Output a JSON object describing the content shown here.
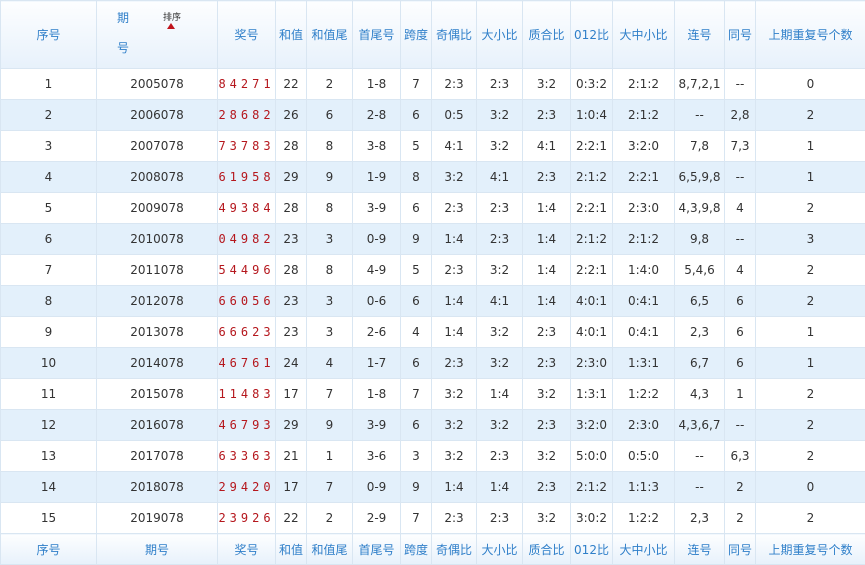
{
  "header": {
    "xuhao": "序号",
    "qihao_1": "期",
    "qihao_2": "号",
    "sort_label": "排序",
    "jianghao": "奖号",
    "hezhi": "和值",
    "hezhiwei": "和值尾",
    "shouweihao": "首尾号",
    "kuadu": "跨度",
    "jiou": "奇偶比",
    "daxiao": "大小比",
    "zhihe": "质合比",
    "b012": "012比",
    "dazhongxiao": "大中小比",
    "lianhao": "连号",
    "tonghao": "同号",
    "chongfu": "上期重复号个数"
  },
  "footer": {
    "xuhao": "序号",
    "qihao": "期号",
    "jianghao": "奖号",
    "hezhi": "和值",
    "hezhiwei": "和值尾",
    "shouweihao": "首尾号",
    "kuadu": "跨度",
    "jiou": "奇偶比",
    "daxiao": "大小比",
    "zhihe": "质合比",
    "b012": "012比",
    "dazhongxiao": "大中小比",
    "lianhao": "连号",
    "tonghao": "同号",
    "chongfu": "上期重复号个数"
  },
  "rows": [
    {
      "xuhao": "1",
      "qihao": "2005078",
      "jianghao": "84271",
      "hezhi": "22",
      "hezhiwei": "2",
      "shouweihao": "1-8",
      "kuadu": "7",
      "jiou": "2:3",
      "daxiao": "2:3",
      "zhihe": "3:2",
      "b012": "0:3:2",
      "dazhongxiao": "2:1:2",
      "lianhao": "8,7,2,1",
      "tonghao": "--",
      "chongfu": "0"
    },
    {
      "xuhao": "2",
      "qihao": "2006078",
      "jianghao": "28682",
      "hezhi": "26",
      "hezhiwei": "6",
      "shouweihao": "2-8",
      "kuadu": "6",
      "jiou": "0:5",
      "daxiao": "3:2",
      "zhihe": "2:3",
      "b012": "1:0:4",
      "dazhongxiao": "2:1:2",
      "lianhao": "--",
      "tonghao": "2,8",
      "chongfu": "2"
    },
    {
      "xuhao": "3",
      "qihao": "2007078",
      "jianghao": "73783",
      "hezhi": "28",
      "hezhiwei": "8",
      "shouweihao": "3-8",
      "kuadu": "5",
      "jiou": "4:1",
      "daxiao": "3:2",
      "zhihe": "4:1",
      "b012": "2:2:1",
      "dazhongxiao": "3:2:0",
      "lianhao": "7,8",
      "tonghao": "7,3",
      "chongfu": "1"
    },
    {
      "xuhao": "4",
      "qihao": "2008078",
      "jianghao": "61958",
      "hezhi": "29",
      "hezhiwei": "9",
      "shouweihao": "1-9",
      "kuadu": "8",
      "jiou": "3:2",
      "daxiao": "4:1",
      "zhihe": "2:3",
      "b012": "2:1:2",
      "dazhongxiao": "2:2:1",
      "lianhao": "6,5,9,8",
      "tonghao": "--",
      "chongfu": "1"
    },
    {
      "xuhao": "5",
      "qihao": "2009078",
      "jianghao": "49384",
      "hezhi": "28",
      "hezhiwei": "8",
      "shouweihao": "3-9",
      "kuadu": "6",
      "jiou": "2:3",
      "daxiao": "2:3",
      "zhihe": "1:4",
      "b012": "2:2:1",
      "dazhongxiao": "2:3:0",
      "lianhao": "4,3,9,8",
      "tonghao": "4",
      "chongfu": "2"
    },
    {
      "xuhao": "6",
      "qihao": "2010078",
      "jianghao": "04982",
      "hezhi": "23",
      "hezhiwei": "3",
      "shouweihao": "0-9",
      "kuadu": "9",
      "jiou": "1:4",
      "daxiao": "2:3",
      "zhihe": "1:4",
      "b012": "2:1:2",
      "dazhongxiao": "2:1:2",
      "lianhao": "9,8",
      "tonghao": "--",
      "chongfu": "3"
    },
    {
      "xuhao": "7",
      "qihao": "2011078",
      "jianghao": "54496",
      "hezhi": "28",
      "hezhiwei": "8",
      "shouweihao": "4-9",
      "kuadu": "5",
      "jiou": "2:3",
      "daxiao": "3:2",
      "zhihe": "1:4",
      "b012": "2:2:1",
      "dazhongxiao": "1:4:0",
      "lianhao": "5,4,6",
      "tonghao": "4",
      "chongfu": "2"
    },
    {
      "xuhao": "8",
      "qihao": "2012078",
      "jianghao": "66056",
      "hezhi": "23",
      "hezhiwei": "3",
      "shouweihao": "0-6",
      "kuadu": "6",
      "jiou": "1:4",
      "daxiao": "4:1",
      "zhihe": "1:4",
      "b012": "4:0:1",
      "dazhongxiao": "0:4:1",
      "lianhao": "6,5",
      "tonghao": "6",
      "chongfu": "2"
    },
    {
      "xuhao": "9",
      "qihao": "2013078",
      "jianghao": "66623",
      "hezhi": "23",
      "hezhiwei": "3",
      "shouweihao": "2-6",
      "kuadu": "4",
      "jiou": "1:4",
      "daxiao": "3:2",
      "zhihe": "2:3",
      "b012": "4:0:1",
      "dazhongxiao": "0:4:1",
      "lianhao": "2,3",
      "tonghao": "6",
      "chongfu": "1"
    },
    {
      "xuhao": "10",
      "qihao": "2014078",
      "jianghao": "46761",
      "hezhi": "24",
      "hezhiwei": "4",
      "shouweihao": "1-7",
      "kuadu": "6",
      "jiou": "2:3",
      "daxiao": "3:2",
      "zhihe": "2:3",
      "b012": "2:3:0",
      "dazhongxiao": "1:3:1",
      "lianhao": "6,7",
      "tonghao": "6",
      "chongfu": "1"
    },
    {
      "xuhao": "11",
      "qihao": "2015078",
      "jianghao": "11483",
      "hezhi": "17",
      "hezhiwei": "7",
      "shouweihao": "1-8",
      "kuadu": "7",
      "jiou": "3:2",
      "daxiao": "1:4",
      "zhihe": "3:2",
      "b012": "1:3:1",
      "dazhongxiao": "1:2:2",
      "lianhao": "4,3",
      "tonghao": "1",
      "chongfu": "2"
    },
    {
      "xuhao": "12",
      "qihao": "2016078",
      "jianghao": "46793",
      "hezhi": "29",
      "hezhiwei": "9",
      "shouweihao": "3-9",
      "kuadu": "6",
      "jiou": "3:2",
      "daxiao": "3:2",
      "zhihe": "2:3",
      "b012": "3:2:0",
      "dazhongxiao": "2:3:0",
      "lianhao": "4,3,6,7",
      "tonghao": "--",
      "chongfu": "2"
    },
    {
      "xuhao": "13",
      "qihao": "2017078",
      "jianghao": "63363",
      "hezhi": "21",
      "hezhiwei": "1",
      "shouweihao": "3-6",
      "kuadu": "3",
      "jiou": "3:2",
      "daxiao": "2:3",
      "zhihe": "3:2",
      "b012": "5:0:0",
      "dazhongxiao": "0:5:0",
      "lianhao": "--",
      "tonghao": "6,3",
      "chongfu": "2"
    },
    {
      "xuhao": "14",
      "qihao": "2018078",
      "jianghao": "29420",
      "hezhi": "17",
      "hezhiwei": "7",
      "shouweihao": "0-9",
      "kuadu": "9",
      "jiou": "1:4",
      "daxiao": "1:4",
      "zhihe": "2:3",
      "b012": "2:1:2",
      "dazhongxiao": "1:1:3",
      "lianhao": "--",
      "tonghao": "2",
      "chongfu": "0"
    },
    {
      "xuhao": "15",
      "qihao": "2019078",
      "jianghao": "23926",
      "hezhi": "22",
      "hezhiwei": "2",
      "shouweihao": "2-9",
      "kuadu": "7",
      "jiou": "2:3",
      "daxiao": "2:3",
      "zhihe": "3:2",
      "b012": "3:0:2",
      "dazhongxiao": "1:2:2",
      "lianhao": "2,3",
      "tonghao": "2",
      "chongfu": "2"
    }
  ]
}
